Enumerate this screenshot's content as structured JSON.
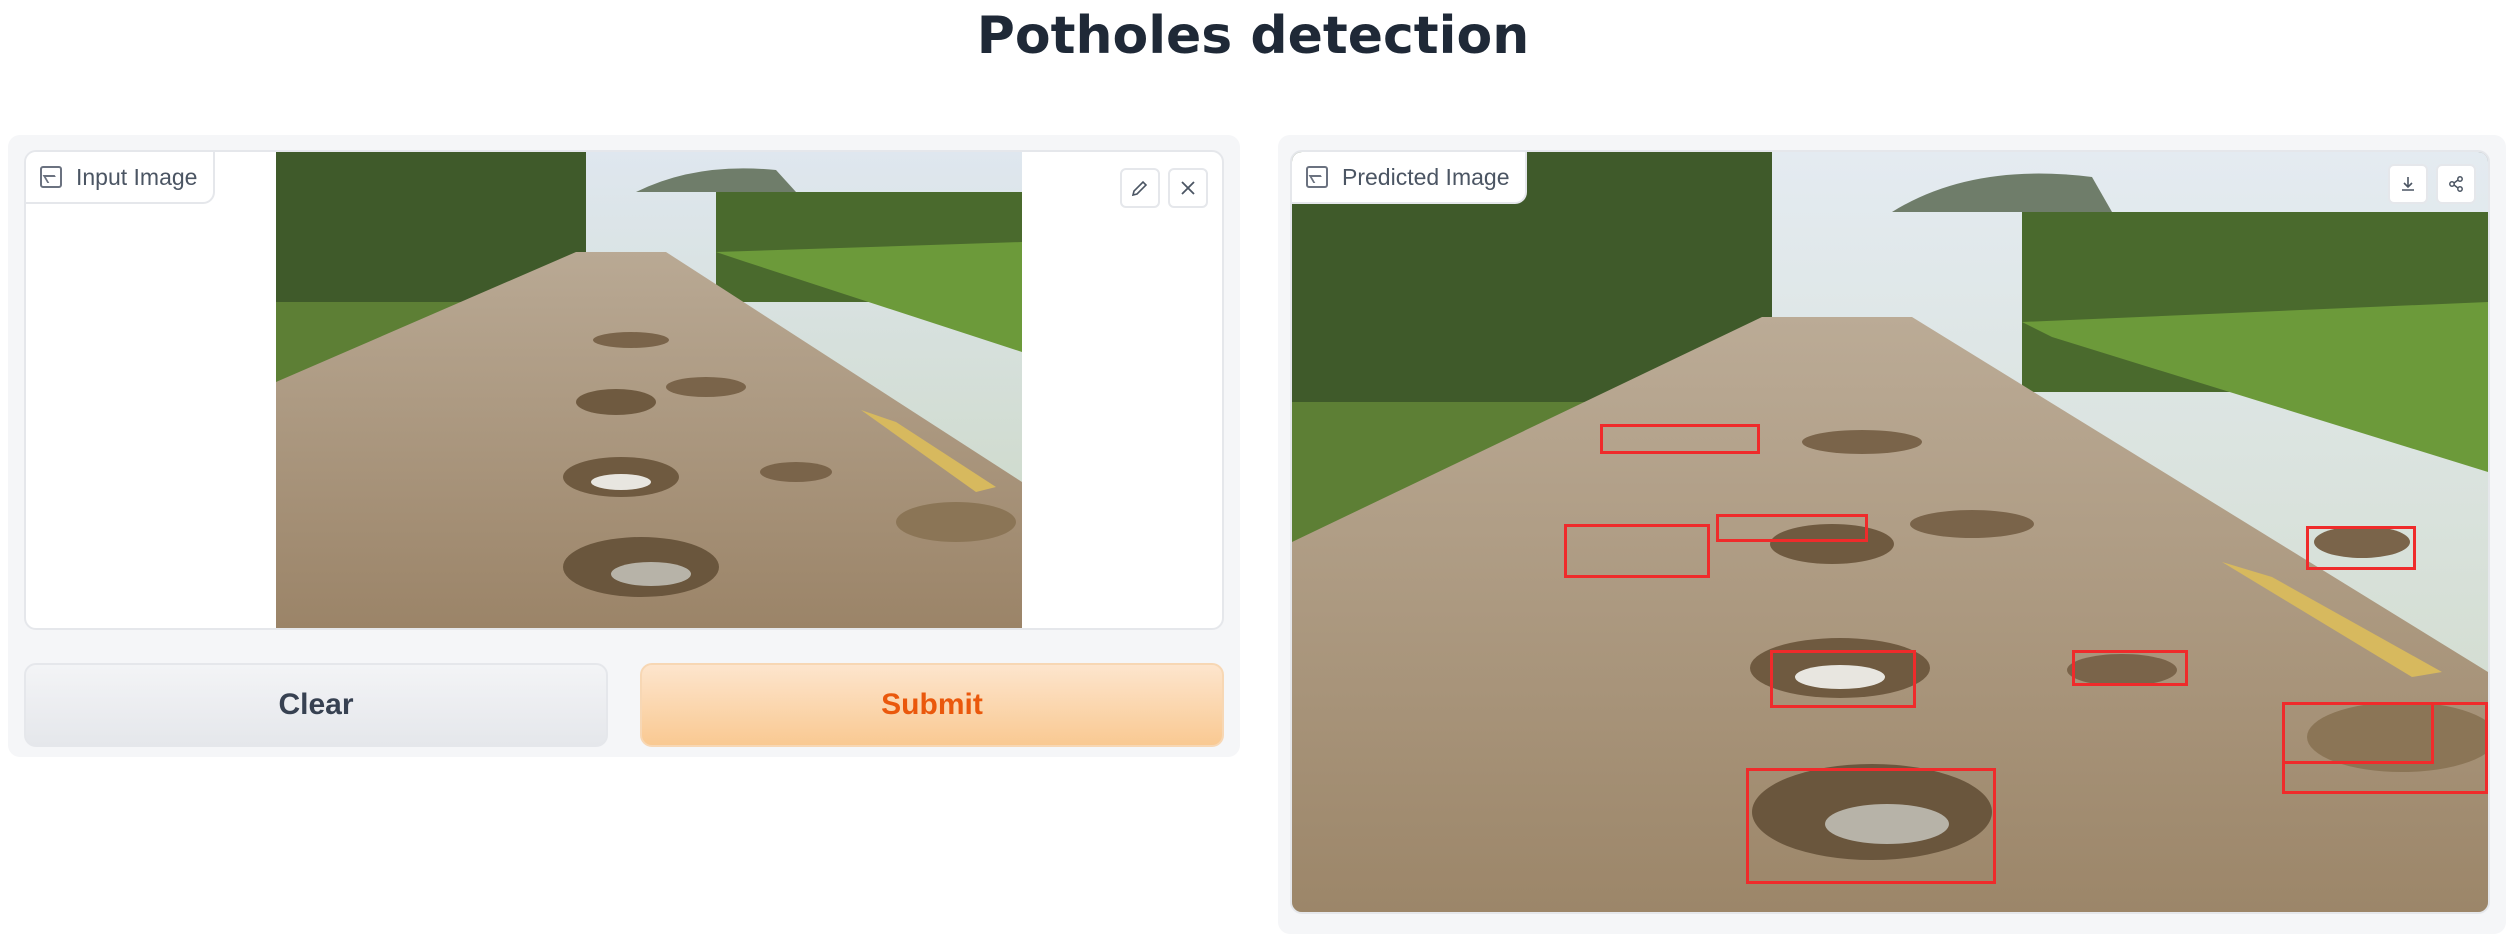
{
  "page": {
    "title": "Potholes detection"
  },
  "input": {
    "label": "Input Image",
    "edit_icon": "pencil-icon",
    "close_icon": "close-icon"
  },
  "output": {
    "label": "Predicted Image",
    "download_icon": "download-icon",
    "share_icon": "share-icon"
  },
  "buttons": {
    "clear_label": "Clear",
    "submit_label": "Submit"
  },
  "colors": {
    "accent": "#ea580c",
    "submit_bg": "#f9c992",
    "detection_box": "#ef2b2b",
    "panel_bg": "#f5f6f8"
  }
}
